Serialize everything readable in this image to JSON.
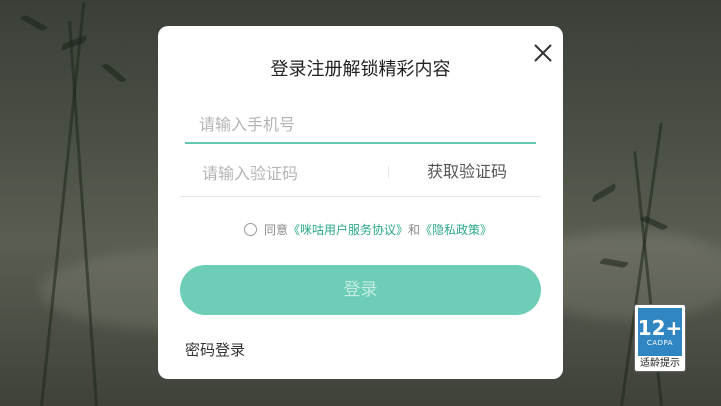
{
  "dialog": {
    "title": "登录注册解锁精彩内容",
    "phone_placeholder": "请输入手机号",
    "code_placeholder": "请输入验证码",
    "get_code_label": "获取验证码",
    "agreement": {
      "prefix": "同意",
      "user_agreement": "《咪咕用户服务协议》",
      "and": "和",
      "privacy_policy": "《隐私政策》"
    },
    "login_label": "登录",
    "password_login_label": "密码登录"
  },
  "age_rating": {
    "number": "12+",
    "org": "CADPA",
    "tip": "适龄提示"
  },
  "colors": {
    "accent": "#63c9b1",
    "button": "#6dcdb7",
    "link": "#2aa889",
    "rating_blue": "#2f86c2"
  },
  "icons": {
    "close": "close-icon",
    "checkbox": "radio-circle-icon"
  }
}
